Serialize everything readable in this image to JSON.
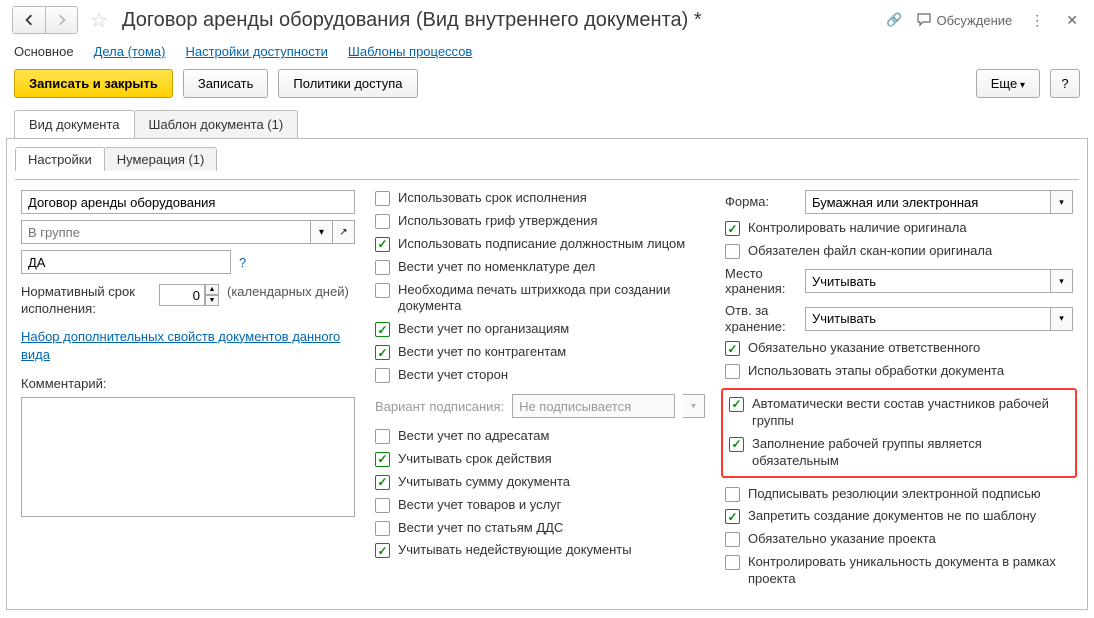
{
  "header": {
    "title": "Договор аренды оборудования (Вид внутреннего документа) *",
    "discuss": "Обсуждение"
  },
  "mainTabs": {
    "t1": "Основное",
    "t2": "Дела (тома)",
    "t3": "Настройки доступности",
    "t4": "Шаблоны процессов"
  },
  "toolbar": {
    "saveClose": "Записать и закрыть",
    "save": "Записать",
    "policies": "Политики доступа",
    "more": "Еще",
    "help": "?"
  },
  "docTabs": {
    "t1": "Вид документа",
    "t2": "Шаблон документа (1)"
  },
  "subTabs": {
    "t1": "Настройки",
    "t2": "Нумерация (1)"
  },
  "left": {
    "name": "Договор аренды оборудования",
    "groupPlaceholder": "В группе",
    "code": "ДА",
    "normLabel": "Нормативный срок исполнения:",
    "normValue": "0",
    "days": "(календарных дней)",
    "propsLink": "Набор дополнительных свойств документов данного вида",
    "commentLabel": "Комментарий:"
  },
  "mid": {
    "c1": "Использовать срок исполнения",
    "c2": "Использовать гриф утверждения",
    "c3": "Использовать подписание должностным лицом",
    "c4": "Вести учет по номенклатуре дел",
    "c5": "Необходима печать штрихкода при создании документа",
    "c6": "Вести учет по организациям",
    "c7": "Вести учет по контрагентам",
    "c8": "Вести учет сторон",
    "variantLabel": "Вариант подписания:",
    "variantValue": "Не подписывается",
    "c9": "Вести учет по адресатам",
    "c10": "Учитывать срок действия",
    "c11": "Учитывать сумму документа",
    "c12": "Вести учет товаров и услуг",
    "c13": "Вести учет по статьям ДДС",
    "c14": "Учитывать недействующие документы"
  },
  "right": {
    "formLabel": "Форма:",
    "formValue": "Бумажная или электронная",
    "c1": "Контролировать наличие оригинала",
    "c2": "Обязателен файл скан-копии оригинала",
    "storageLabel": "Место хранения:",
    "storageValue": "Учитывать",
    "respLabel": "Отв. за хранение:",
    "respValue": "Учитывать",
    "c3": "Обязательно указание ответственного",
    "c4": "Использовать этапы обработки документа",
    "c5": "Автоматически вести состав участников рабочей группы",
    "c6": "Заполнение рабочей группы является обязательным",
    "c7": "Подписывать резолюции электронной подписью",
    "c8": "Запретить создание документов не по шаблону",
    "c9": "Обязательно указание проекта",
    "c10": "Контролировать уникальность документа в рамках проекта"
  }
}
